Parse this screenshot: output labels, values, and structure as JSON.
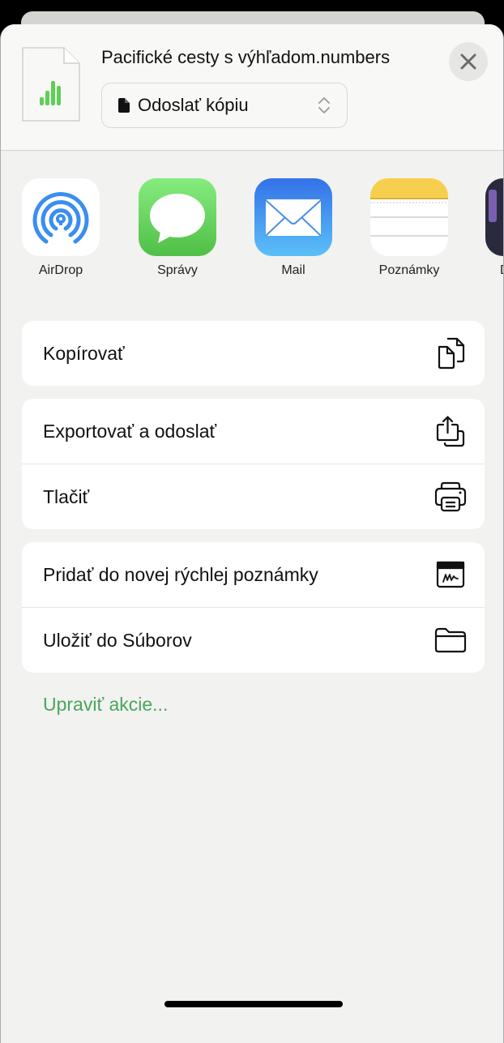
{
  "header": {
    "file_name": "Pacifické cesty s výhľadom.numbers",
    "mode_select": {
      "value": "Odoslať kópiu"
    },
    "close_icon": "close-icon",
    "doc_icon": "numbers-document-icon"
  },
  "apps": [
    {
      "label": "AirDrop",
      "icon": "airdrop-icon"
    },
    {
      "label": "Správy",
      "icon": "messages-icon"
    },
    {
      "label": "Mail",
      "icon": "mail-icon"
    },
    {
      "label": "Poznámky",
      "icon": "notes-icon"
    },
    {
      "label": "D",
      "icon": "partial-app-icon"
    }
  ],
  "action_groups": [
    [
      {
        "label": "Kopírovať",
        "icon": "copy-icon"
      }
    ],
    [
      {
        "label": "Exportovať a odoslať",
        "icon": "export-share-icon"
      },
      {
        "label": "Tlačiť",
        "icon": "printer-icon"
      }
    ],
    [
      {
        "label": "Pridať do novej rýchlej poznámky",
        "icon": "quick-note-icon"
      },
      {
        "label": "Uložiť do Súborov",
        "icon": "folder-icon"
      }
    ]
  ],
  "edit_actions_label": "Upraviť akcie...",
  "colors": {
    "accent": "#4aa55e",
    "background": "#f2f2f0",
    "card": "#ffffff"
  }
}
